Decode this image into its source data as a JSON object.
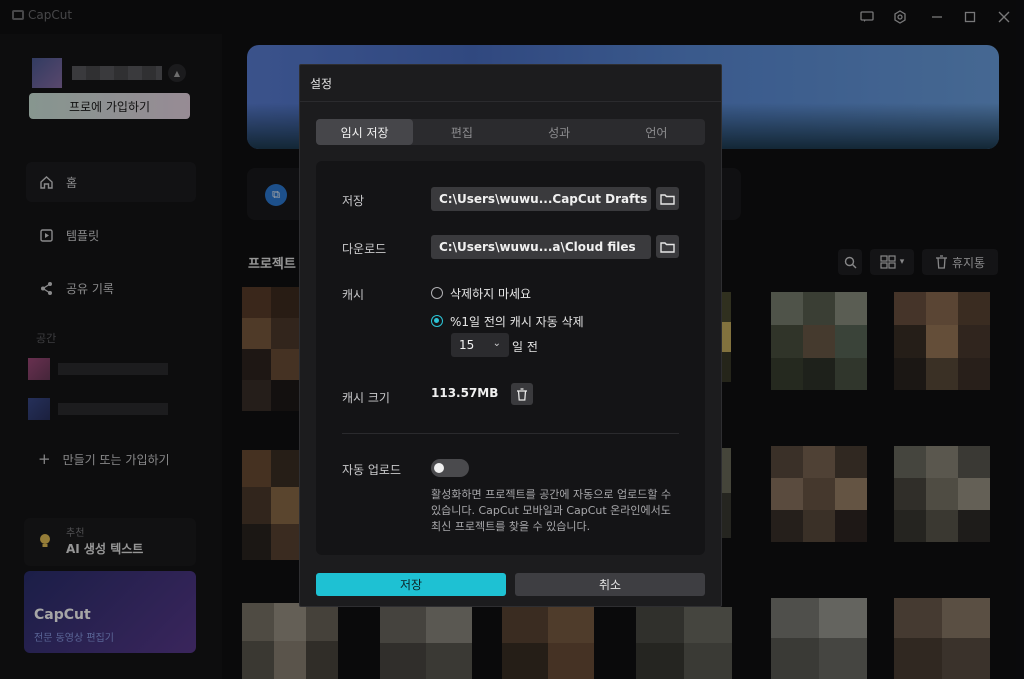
{
  "app": {
    "name": "CapCut"
  },
  "titlebar": {
    "icons": [
      "feedback-icon",
      "settings-icon"
    ],
    "window_controls": [
      "minimize-icon",
      "maximize-icon",
      "close-icon"
    ]
  },
  "sidebar": {
    "pro_button": "프로에 가입하기",
    "nav": [
      {
        "label": "홈",
        "icon": "home-icon"
      },
      {
        "label": "템플릿",
        "icon": "template-icon"
      },
      {
        "label": "공유 기록",
        "icon": "share-icon"
      }
    ],
    "section_label": "공간",
    "create_join": "만들기 또는 가입하기",
    "promo": {
      "tag": "추천",
      "title": "AI 생성 텍스트"
    },
    "brand": {
      "title": "CapCut",
      "subtitle": "전문 동영상 편집기"
    }
  },
  "main": {
    "projects_title": "프로젝트",
    "trash_label": "휴지통"
  },
  "settings_dialog": {
    "title": "설정",
    "tabs": [
      {
        "label": "임시 저장",
        "active": true
      },
      {
        "label": "편집",
        "active": false
      },
      {
        "label": "성과",
        "active": false
      },
      {
        "label": "언어",
        "active": false
      }
    ],
    "save_label": "저장",
    "save_path": "C:\\Users\\wuwu...CapCut Drafts",
    "download_label": "다운로드",
    "download_path": "C:\\Users\\wuwu...a\\Cloud files",
    "cache_label": "캐시",
    "cache_options": [
      {
        "label": "삭제하지 마세요",
        "checked": false
      },
      {
        "label": "%1일 전의 캐시 자동 삭제",
        "checked": true
      }
    ],
    "days_value": "15",
    "days_suffix": "일 전",
    "cache_size_label": "캐시 크기",
    "cache_size_value": "113.57MB",
    "auto_upload_label": "자동 업로드",
    "auto_upload_on": false,
    "auto_upload_desc": "활성화하면 프로젝트를 공간에 자동으로 업로드할 수 있습니다. CapCut 모바일과 CapCut 온라인에서도 최신 프로젝트를 찾을 수 있습니다.",
    "save_button": "저장",
    "cancel_button": "취소"
  },
  "colors": {
    "accent": "#1ec1d3",
    "panel": "#1c1c1e",
    "background": "#101012"
  }
}
